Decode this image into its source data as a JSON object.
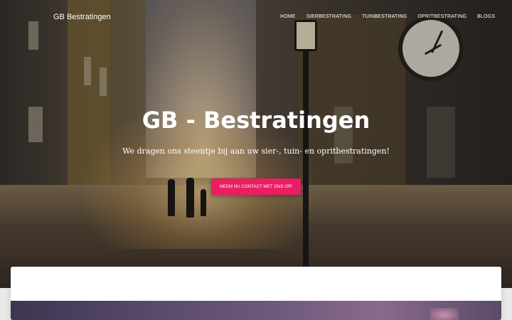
{
  "header": {
    "brand": "GB Bestratingen",
    "nav": [
      {
        "label": "HOME"
      },
      {
        "label": "SIERBESTRATING"
      },
      {
        "label": "TUINBESTRATING"
      },
      {
        "label": "OPRITBESTRATING"
      },
      {
        "label": "BLOGS"
      }
    ]
  },
  "hero": {
    "title": "GB - Bestratingen",
    "subtitle": "We dragen ons steentje bij aan uw sier-, tuin- en opritbestratingen!",
    "cta_label": "NEEM NU CONTACT MET ONS OP!"
  },
  "colors": {
    "accent": "#e91e63",
    "text_light": "#ffffff",
    "page_background": "#e9e9e9"
  }
}
